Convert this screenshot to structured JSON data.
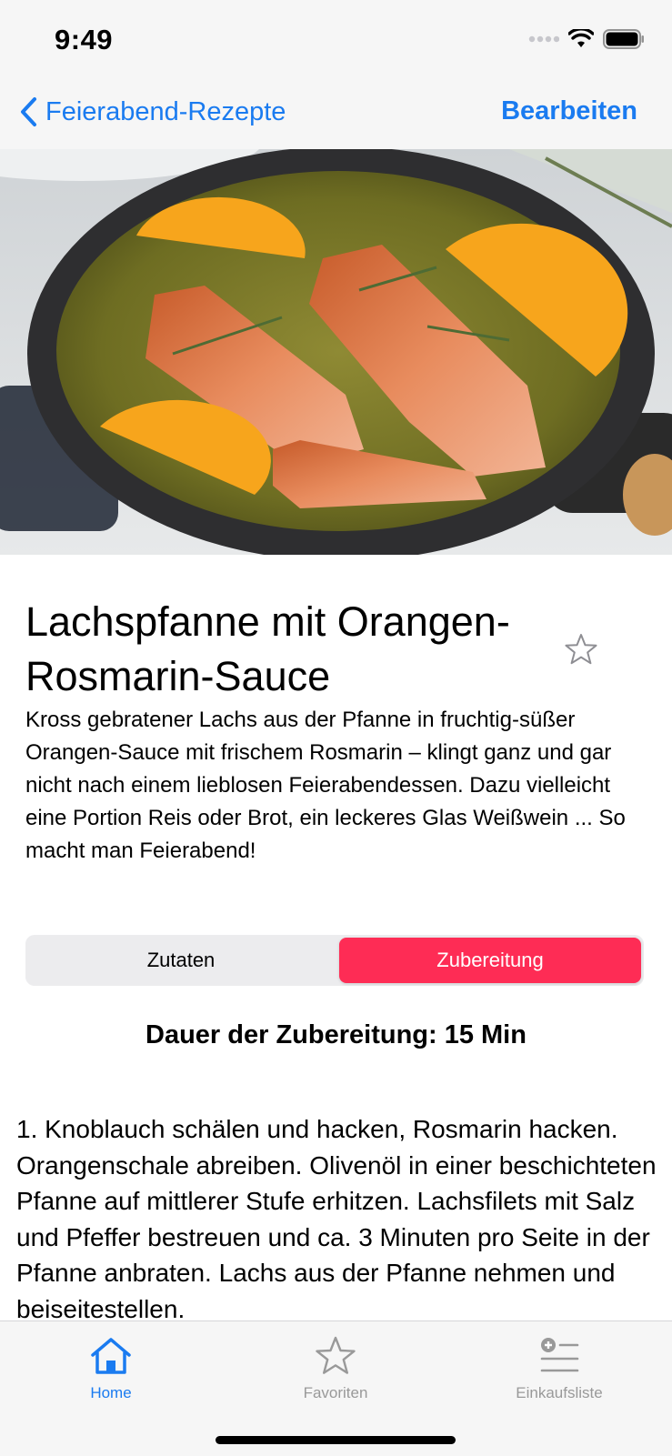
{
  "status": {
    "time": "9:49"
  },
  "nav": {
    "back_label": "Feierabend-Rezepte",
    "edit_label": "Bearbeiten"
  },
  "recipe": {
    "title": "Lachspfanne mit Orangen-Rosmarin-Sauce",
    "description": "Kross gebratener Lachs aus der Pfanne in fruchtig-süßer Orangen-Sauce mit frischem Rosmarin – klingt ganz und gar nicht nach einem lieblosen Feierabendessen. Dazu vielleicht eine Portion Reis oder Brot, ein leckeres Glas Weißwein ... So macht man Feierabend!",
    "favorite": false
  },
  "segments": {
    "ingredients": "Zutaten",
    "preparation": "Zubereitung",
    "selected": "preparation"
  },
  "preparation": {
    "duration": "Dauer der Zubereitung: 15 Min",
    "step1": "1. Knoblauch schälen und hacken, Rosmarin hacken. Orangenschale abreiben. Olivenöl in einer beschichteten Pfanne auf mittlerer Stufe erhitzen. Lachsfilets mit Salz und Pfeffer bestreuen und ca. 3 Minuten pro Seite in der Pfanne anbraten. Lachs aus der Pfanne nehmen und beiseitestellen."
  },
  "tabs": {
    "home": "Home",
    "favorites": "Favoriten",
    "shopping": "Einkaufsliste",
    "selected": "home"
  },
  "colors": {
    "accent": "#1a7bf0",
    "segment_active": "#fe2c55",
    "tab_inactive": "#999999"
  }
}
